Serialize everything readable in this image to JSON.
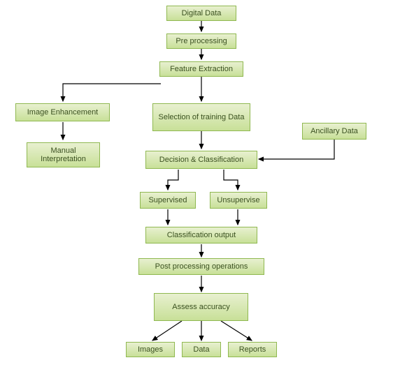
{
  "chart_data": {
    "type": "diagram",
    "title": "",
    "nodes": [
      {
        "id": "digital-data",
        "label": "Digital Data"
      },
      {
        "id": "pre-processing",
        "label": "Pre processing"
      },
      {
        "id": "feature-extraction",
        "label": "Feature Extraction"
      },
      {
        "id": "image-enhancement",
        "label": "Image Enhancement"
      },
      {
        "id": "manual-interpretation",
        "label": "Manual Interpretation"
      },
      {
        "id": "selection-training",
        "label": "Selection of training Data"
      },
      {
        "id": "decision-classification",
        "label": "Decision & Classification"
      },
      {
        "id": "ancillary-data",
        "label": "Ancillary Data"
      },
      {
        "id": "supervised",
        "label": "Supervised"
      },
      {
        "id": "unsupervise",
        "label": "Unsupervise"
      },
      {
        "id": "classification-output",
        "label": "Classification output"
      },
      {
        "id": "post-processing",
        "label": "Post processing operations"
      },
      {
        "id": "assess-accuracy",
        "label": "Assess accuracy"
      },
      {
        "id": "images",
        "label": "Images"
      },
      {
        "id": "data",
        "label": "Data"
      },
      {
        "id": "reports",
        "label": "Reports"
      }
    ],
    "edges": [
      {
        "from": "digital-data",
        "to": "pre-processing"
      },
      {
        "from": "pre-processing",
        "to": "feature-extraction"
      },
      {
        "from": "feature-extraction",
        "to": "image-enhancement"
      },
      {
        "from": "feature-extraction",
        "to": "selection-training"
      },
      {
        "from": "image-enhancement",
        "to": "manual-interpretation"
      },
      {
        "from": "selection-training",
        "to": "decision-classification"
      },
      {
        "from": "ancillary-data",
        "to": "decision-classification"
      },
      {
        "from": "decision-classification",
        "to": "supervised"
      },
      {
        "from": "decision-classification",
        "to": "unsupervise"
      },
      {
        "from": "supervised",
        "to": "classification-output"
      },
      {
        "from": "unsupervise",
        "to": "classification-output"
      },
      {
        "from": "classification-output",
        "to": "post-processing"
      },
      {
        "from": "post-processing",
        "to": "assess-accuracy"
      },
      {
        "from": "assess-accuracy",
        "to": "images"
      },
      {
        "from": "assess-accuracy",
        "to": "data"
      },
      {
        "from": "assess-accuracy",
        "to": "reports"
      }
    ]
  },
  "nodes": {
    "digital_data": "Digital Data",
    "pre_processing": "Pre processing",
    "feature_extraction": "Feature Extraction",
    "image_enhancement": "Image Enhancement",
    "manual_interpretation": "Manual Interpretation",
    "selection_training": "Selection of training Data",
    "decision_classification": "Decision & Classification",
    "ancillary_data": "Ancillary Data",
    "supervised": "Supervised",
    "unsupervise": "Unsupervise",
    "classification_output": "Classification output",
    "post_processing": "Post processing operations",
    "assess_accuracy": "Assess accuracy",
    "images": "Images",
    "data": "Data",
    "reports": "Reports"
  }
}
